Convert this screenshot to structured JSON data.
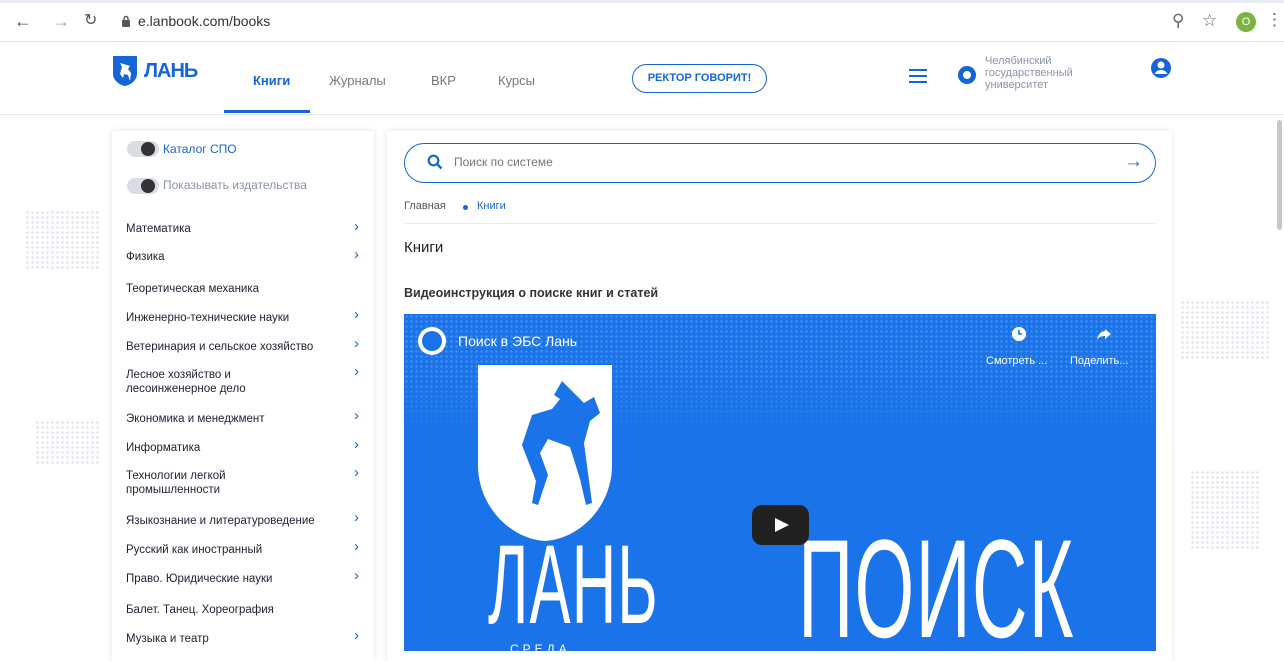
{
  "browser": {
    "url": "e.lanbook.com/books",
    "profile_initial": "O"
  },
  "header": {
    "logo_text": "ЛАНЬ",
    "nav": [
      {
        "label": "Книги"
      },
      {
        "label": "Журналы"
      },
      {
        "label": "ВКР"
      },
      {
        "label": "Курсы"
      }
    ],
    "rektor_label": "РЕКТОР ГОВОРИТ!",
    "university": [
      "Челябинский",
      "государственный",
      "университет"
    ]
  },
  "sidebar": {
    "toggles": [
      {
        "label": "Каталог СПО"
      },
      {
        "label": "Показывать издательства"
      }
    ],
    "categories": [
      {
        "label": "Математика"
      },
      {
        "label": "Физика"
      },
      {
        "label": "Теоретическая механика"
      },
      {
        "label": "Инженерно-технические науки"
      },
      {
        "label": "Ветеринария и сельское хозяйство"
      },
      {
        "label": "Лесное хозяйство и лесоинженерное дело"
      },
      {
        "label": "Экономика и менеджмент"
      },
      {
        "label": "Информатика"
      },
      {
        "label": "Технологии легкой промышленности"
      },
      {
        "label": "Языкознание и литературоведение"
      },
      {
        "label": "Русский как иностранный"
      },
      {
        "label": "Право. Юридические науки"
      },
      {
        "label": "Балет. Танец. Хореография"
      },
      {
        "label": "Музыка и театр"
      }
    ]
  },
  "search": {
    "placeholder": "Поиск по системе"
  },
  "breadcrumb": [
    "Главная",
    "Книги"
  ],
  "page_title": "Книги",
  "video": {
    "heading": "Видеоинструкция о поиске книг и статей",
    "title": "Поиск в ЭБС Лань",
    "watch_later": "Смотреть ...",
    "share": "Поделить...",
    "big_left": "ЛАНЬ",
    "big_left_sub": "СРЕДА",
    "big_right": "ПОИСК"
  },
  "colors": {
    "brand": "#1565d8",
    "video_bg": "#1a73e8"
  }
}
